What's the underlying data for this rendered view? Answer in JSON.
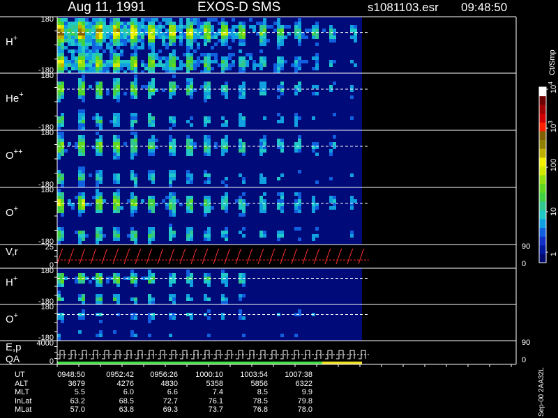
{
  "header": {
    "date": "Aug 11, 1991",
    "instrument": "EXOS-D SMS",
    "file": "s1081103.esr",
    "time": "09:48:50"
  },
  "chart_data": {
    "type": "heatmap",
    "panels": [
      {
        "id": "h_plus",
        "label": "H",
        "sup": "+",
        "ymax": "180",
        "ymin": "-180"
      },
      {
        "id": "he_plus",
        "label": "He",
        "sup": "+",
        "ymax": "180",
        "ymin": "-180"
      },
      {
        "id": "o_pp",
        "label": "O",
        "sup": "++",
        "ymax": "180",
        "ymin": "-180"
      },
      {
        "id": "o_plus",
        "label": "O",
        "sup": "+",
        "ymax": "180",
        "ymin": "-180"
      },
      {
        "id": "vr",
        "label": "V,r",
        "sup": "",
        "ymax": "25",
        "ymin": "0",
        "right_top": "90",
        "right_bottom": "0"
      },
      {
        "id": "h_plus2",
        "label": "H",
        "sup": "+",
        "ymax": "180",
        "ymin": "-180"
      },
      {
        "id": "o_plus2",
        "label": "O",
        "sup": "+",
        "ymax": "180",
        "ymin": "-180"
      },
      {
        "id": "ep",
        "label": "E,p",
        "label2": "QA",
        "sup": "",
        "ymax": "4000",
        "ymin": "0",
        "right_top": "90",
        "right_bottom": "0"
      }
    ],
    "colorbar": {
      "unit": "Ct/Smp",
      "ticks": [
        "1",
        "10",
        "100",
        "10",
        "10"
      ],
      "exponents": [
        "",
        "",
        "",
        "3",
        "4"
      ],
      "colors": [
        "#000a6e",
        "#0018a0",
        "#1030c8",
        "#1060e0",
        "#10a0e0",
        "#20c8c8",
        "#30c890",
        "#40d040",
        "#60d820",
        "#90e010",
        "#d0e800",
        "#f0f000",
        "#c0b000",
        "#908000",
        "#806000",
        "#ff2000",
        "#d00000",
        "#a00000",
        "#700000",
        "#ffffff"
      ]
    },
    "time_axis": {
      "row_labels": [
        "UT",
        "ALT",
        "MLT",
        "InLat",
        "MLat"
      ],
      "columns": [
        {
          "UT": "0948:50",
          "ALT": "3679",
          "MLT": "5.5",
          "InLat": "63.2",
          "MLat": "57.0"
        },
        {
          "UT": "0952:42",
          "ALT": "4276",
          "MLT": "6.0",
          "InLat": "68.5",
          "MLat": "63.8"
        },
        {
          "UT": "0956:26",
          "ALT": "4830",
          "MLT": "6.6",
          "InLat": "72.7",
          "MLat": "69.3"
        },
        {
          "UT": "1000:10",
          "ALT": "5358",
          "MLT": "7.4",
          "InLat": "76.1",
          "MLat": "73.7"
        },
        {
          "UT": "1003:54",
          "ALT": "5856",
          "MLT": "8.5",
          "InLat": "78.5",
          "MLat": "76.8"
        },
        {
          "UT": "1007:38",
          "ALT": "6322",
          "MLT": "9.9",
          "InLat": "79.8",
          "MLat": "78.0"
        }
      ]
    }
  },
  "footer": {
    "stamp": "Sep-00 2AA32L"
  }
}
